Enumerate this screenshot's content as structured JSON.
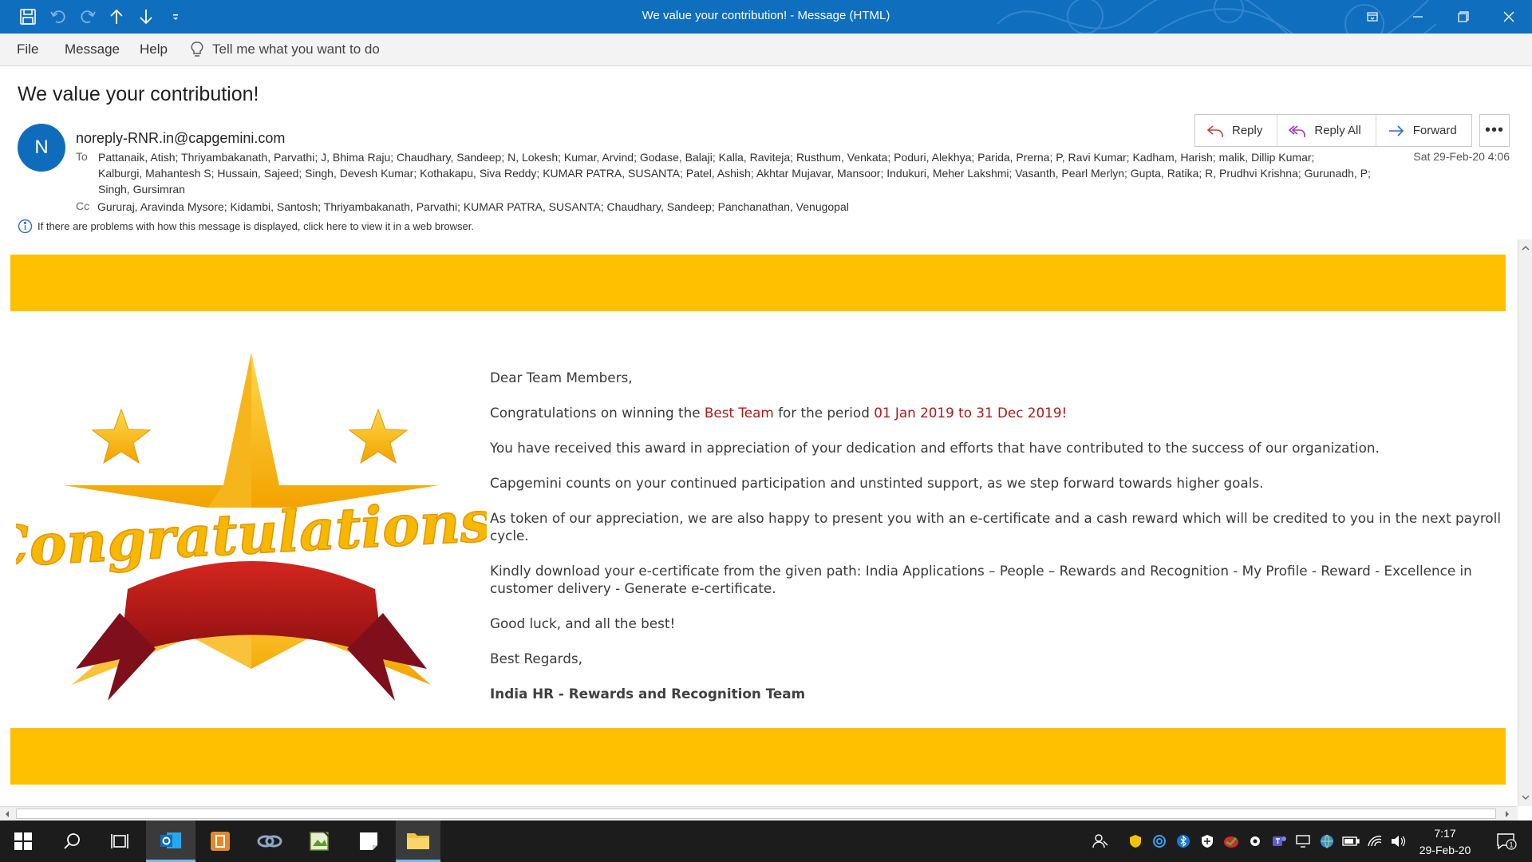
{
  "window": {
    "title": "We value your contribution!  -  Message (HTML)"
  },
  "ribbon": {
    "tabs": [
      "File",
      "Message",
      "Help"
    ],
    "tell_me": "Tell me what you want to do"
  },
  "message": {
    "subject": "We value your contribution!",
    "avatar_initial": "N",
    "sender": "noreply-RNR.in@capgemini.com",
    "to_label": "To",
    "to_lines": [
      "Pattanaik, Atish; Thriyambakanath, Parvathi; J, Bhima Raju; Chaudhary, Sandeep; N, Lokesh; Kumar, Arvind; Godase, Balaji; Kalla, Raviteja; Rusthum, Venkata; Poduri, Alekhya; Parida, Prerna; P, Ravi Kumar; Kadham, Harish; malik, Dillip Kumar;",
      "Kalburgi, Mahantesh S; Hussain, Sajeed; Singh, Devesh Kumar; Kothakapu, Siva Reddy; KUMAR PATRA, SUSANTA; Patel, Ashish; Akhtar Mujavar, Mansoor; Indukuri, Meher Lakshmi; Vasanth, Pearl Merlyn; Gupta, Ratika; R, Prudhvi Krishna; Gurunadh, P;",
      "Singh, Gursimran"
    ],
    "cc_label": "Cc",
    "cc": "Gururaj, Aravinda Mysore; Kidambi, Santosh; Thriyambakanath, Parvathi; KUMAR PATRA, SUSANTA; Chaudhary, Sandeep; Panchanathan, Venugopal",
    "date": "Sat 29-Feb-20 4:06",
    "actions": {
      "reply": "Reply",
      "reply_all": "Reply All",
      "forward": "Forward",
      "more": "•••"
    },
    "info_bar": "If there are problems with how this message is displayed, click here to view it in a web browser."
  },
  "letter": {
    "graphic_text": "Congratulations!",
    "greeting": "Dear Team Members,",
    "congrats_prefix": "Congratulations on winning the ",
    "team_name": "Best Team",
    "congrats_mid": " for the period ",
    "period": "01 Jan 2019 to 31 Dec 2019!",
    "p2": "You have received this award in appreciation of your dedication and efforts that have contributed to the success of our organization.",
    "p3": "Capgemini counts on your continued participation and unstinted support, as we step forward towards higher goals.",
    "p4": "As token of our appreciation, we are also happy to present you with an e-certificate and a cash reward which will be credited to you in the next payroll cycle.",
    "p5": "Kindly download your e-certificate from the given path: India Applications – People – Rewards and Recognition - My Profile - Reward - Excellence in customer delivery - Generate e-certificate.",
    "p6": "Good luck, and all the best!",
    "p7": "Best Regards,",
    "signature": "India HR - Rewards and Recognition Team"
  },
  "taskbar": {
    "time": "7:17",
    "date": "29-Feb-20",
    "notification_count": "1"
  },
  "colors": {
    "titlebar": "#106ebe",
    "band": "#ffc000",
    "highlight_red": "#b11717",
    "avatar": "#0f6cbd"
  }
}
